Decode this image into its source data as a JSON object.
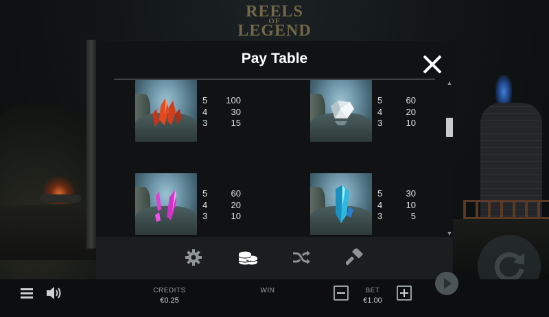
{
  "game": {
    "logo_line1": "REELS",
    "logo_line2": "OF",
    "logo_line3": "LEGEND"
  },
  "modal": {
    "title": "Pay Table",
    "close_icon": "close-icon",
    "symbols": [
      {
        "gem": "red-crystal",
        "pays": [
          {
            "count": "5",
            "amount": "100"
          },
          {
            "count": "4",
            "amount": "30"
          },
          {
            "count": "3",
            "amount": "15"
          }
        ]
      },
      {
        "gem": "white-diamond",
        "pays": [
          {
            "count": "5",
            "amount": "60"
          },
          {
            "count": "4",
            "amount": "20"
          },
          {
            "count": "3",
            "amount": "10"
          }
        ]
      },
      {
        "gem": "pink-crystal",
        "pays": [
          {
            "count": "5",
            "amount": "60"
          },
          {
            "count": "4",
            "amount": "20"
          },
          {
            "count": "3",
            "amount": "10"
          }
        ]
      },
      {
        "gem": "blue-crystal",
        "pays": [
          {
            "count": "5",
            "amount": "30"
          },
          {
            "count": "4",
            "amount": "10"
          },
          {
            "count": "3",
            "amount": "5"
          }
        ]
      }
    ],
    "tabs": [
      {
        "icon": "gear-icon",
        "active": false
      },
      {
        "icon": "coins-icon",
        "active": true
      },
      {
        "icon": "shuffle-icon",
        "active": false
      },
      {
        "icon": "hammer-icon",
        "active": false
      }
    ]
  },
  "controls": {
    "credits_label": "CREDITS",
    "credits_value": "€0.25",
    "win_label": "WIN",
    "win_value": "",
    "bet_label": "BET",
    "bet_value": "€1.00"
  },
  "colors": {
    "modal_bg": "#101213",
    "tabbar_bg": "#1b1d1e",
    "active_tab": "#ffffff",
    "inactive_tab": "#8f9496",
    "pay_text": "#dfe3e4"
  }
}
